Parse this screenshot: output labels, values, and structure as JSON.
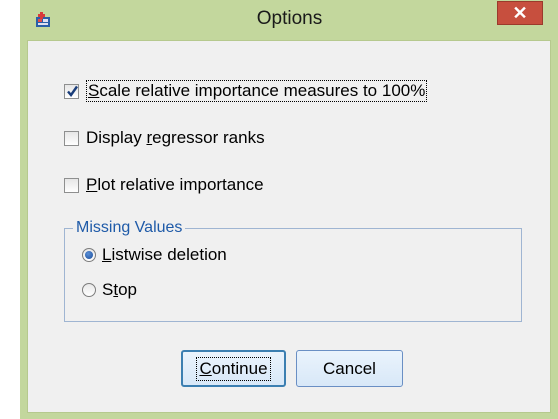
{
  "window": {
    "title": "Options",
    "close_glyph": "✕",
    "icon": "app-icon",
    "frame_color": "#c3d79d",
    "close_color": "#c74f3e"
  },
  "checkboxes": [
    {
      "accel": "S",
      "rest": "cale relative importance measures to 100%",
      "checked": true
    },
    {
      "prefix": "Display ",
      "accel": "r",
      "rest": "egressor ranks",
      "checked": false
    },
    {
      "accel": "P",
      "rest": "lot relative importance",
      "checked": false
    }
  ],
  "missing_values": {
    "legend": "Missing Values",
    "options": [
      {
        "accel": "L",
        "rest": "istwise deletion",
        "selected": true
      },
      {
        "prefix": "S",
        "accel": "t",
        "rest": "op",
        "selected": false
      }
    ]
  },
  "buttons": {
    "continue": {
      "accel": "C",
      "rest": "ontinue"
    },
    "cancel": {
      "label": "Cancel"
    }
  }
}
